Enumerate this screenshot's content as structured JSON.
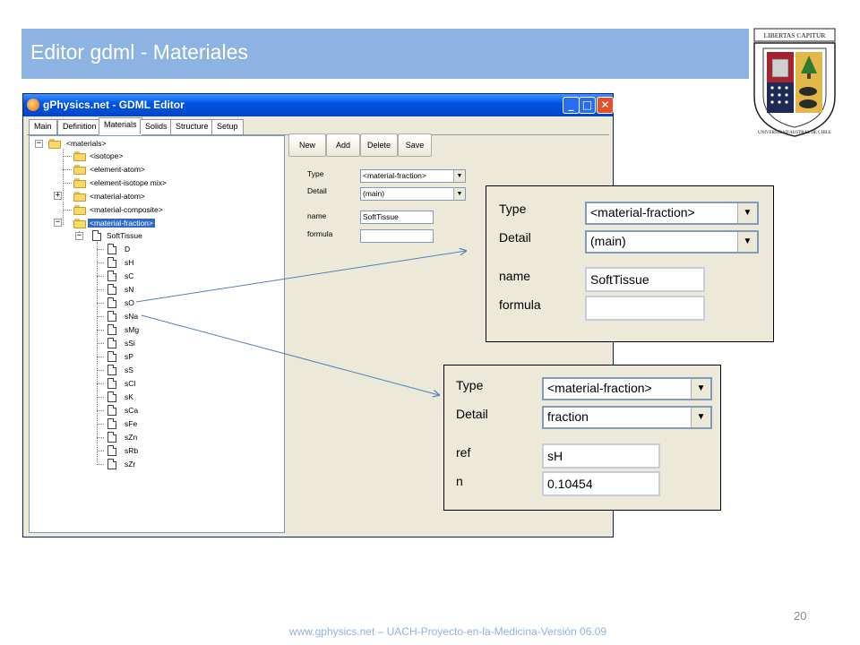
{
  "slide": {
    "title": "Editor gdml - Materiales",
    "page_number": "20",
    "footer": "www.gphysics.net – UACH-Proyecto-en-la-Medicina-Versión 06.09",
    "accent_color": "#8db3e2"
  },
  "seal": {
    "motto": "LIBERTAS CAPITUR",
    "ring_text": "UNIVERSIDAD AUSTRAL DE CHILE"
  },
  "window": {
    "title": "gPhysics.net - GDML Editor",
    "buttons": {
      "minimize": "_",
      "maximize": "□",
      "close": "✕"
    },
    "tabs": [
      {
        "label": "Main"
      },
      {
        "label": "Definition"
      },
      {
        "label": "Materials"
      },
      {
        "label": "Solids"
      },
      {
        "label": "Structure"
      },
      {
        "label": "Setup"
      }
    ],
    "toolbar": {
      "new": "New",
      "add": "Add",
      "delete": "Delete",
      "save": "Save"
    },
    "tree": {
      "root": "<materials>",
      "nodes": [
        "<isotope>",
        "<element-atom>",
        "<element-isotope mix>",
        "<material-atom>",
        "<material-composite>",
        "<material-fraction>"
      ],
      "material": "SoftTissue",
      "components": [
        "D",
        "sH",
        "sC",
        "sN",
        "sO",
        "sNa",
        "sMg",
        "sSi",
        "sP",
        "sS",
        "sCl",
        "sK",
        "sCa",
        "sFe",
        "sZn",
        "sRb",
        "sZr"
      ]
    },
    "form": {
      "type_label": "Type",
      "type_value": "<material-fraction>",
      "detail_label": "Detail",
      "detail_value": "(main)",
      "name_label": "name",
      "name_value": "SoftTissue",
      "formula_label": "formula",
      "formula_value": ""
    }
  },
  "zoom_material": {
    "type_label": "Type",
    "type_value": "<material-fraction>",
    "detail_label": "Detail",
    "detail_value": "(main)",
    "name_label": "name",
    "name_value": "SoftTissue",
    "formula_label": "formula",
    "formula_value": ""
  },
  "zoom_fraction": {
    "type_label": "Type",
    "type_value": "<material-fraction>",
    "detail_label": "Detail",
    "detail_value": "fraction",
    "ref_label": "ref",
    "ref_value": "sH",
    "n_label": "n",
    "n_value": "0.10454"
  }
}
